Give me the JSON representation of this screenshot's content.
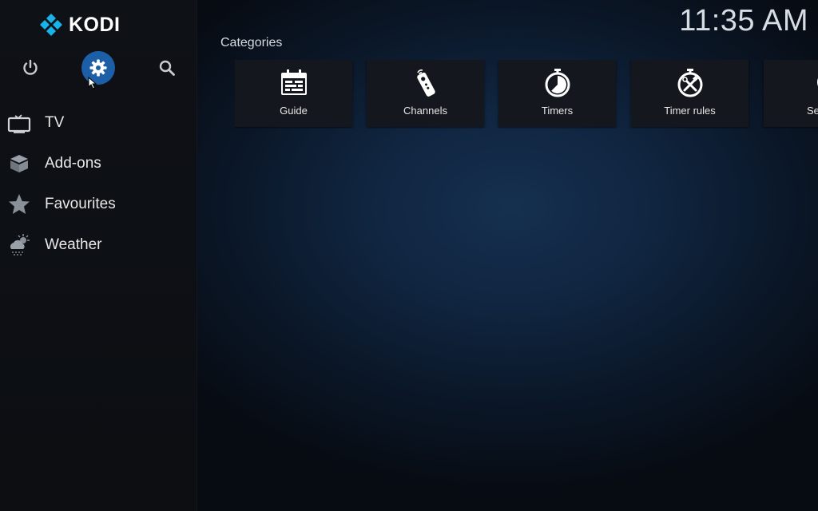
{
  "app": {
    "name": "KODI",
    "brand_color": "#17b2e7",
    "accent_color": "#1d5fa6"
  },
  "clock": {
    "time": "11:35 AM"
  },
  "toolbar": {
    "power_icon": "power-icon",
    "settings_icon": "gear-icon",
    "search_icon": "search-icon"
  },
  "menu": {
    "items": [
      {
        "label": "TV",
        "icon": "tv-icon"
      },
      {
        "label": "Add-ons",
        "icon": "addons-box-icon"
      },
      {
        "label": "Favourites",
        "icon": "star-icon"
      },
      {
        "label": "Weather",
        "icon": "weather-icon"
      }
    ]
  },
  "categories": {
    "title": "Categories",
    "tiles": [
      {
        "label": "Guide",
        "icon": "calendar-icon"
      },
      {
        "label": "Channels",
        "icon": "remote-icon"
      },
      {
        "label": "Timers",
        "icon": "stopwatch-icon"
      },
      {
        "label": "Timer rules",
        "icon": "timer-rules-icon"
      },
      {
        "label": "Se",
        "icon": "search-icon"
      }
    ]
  }
}
